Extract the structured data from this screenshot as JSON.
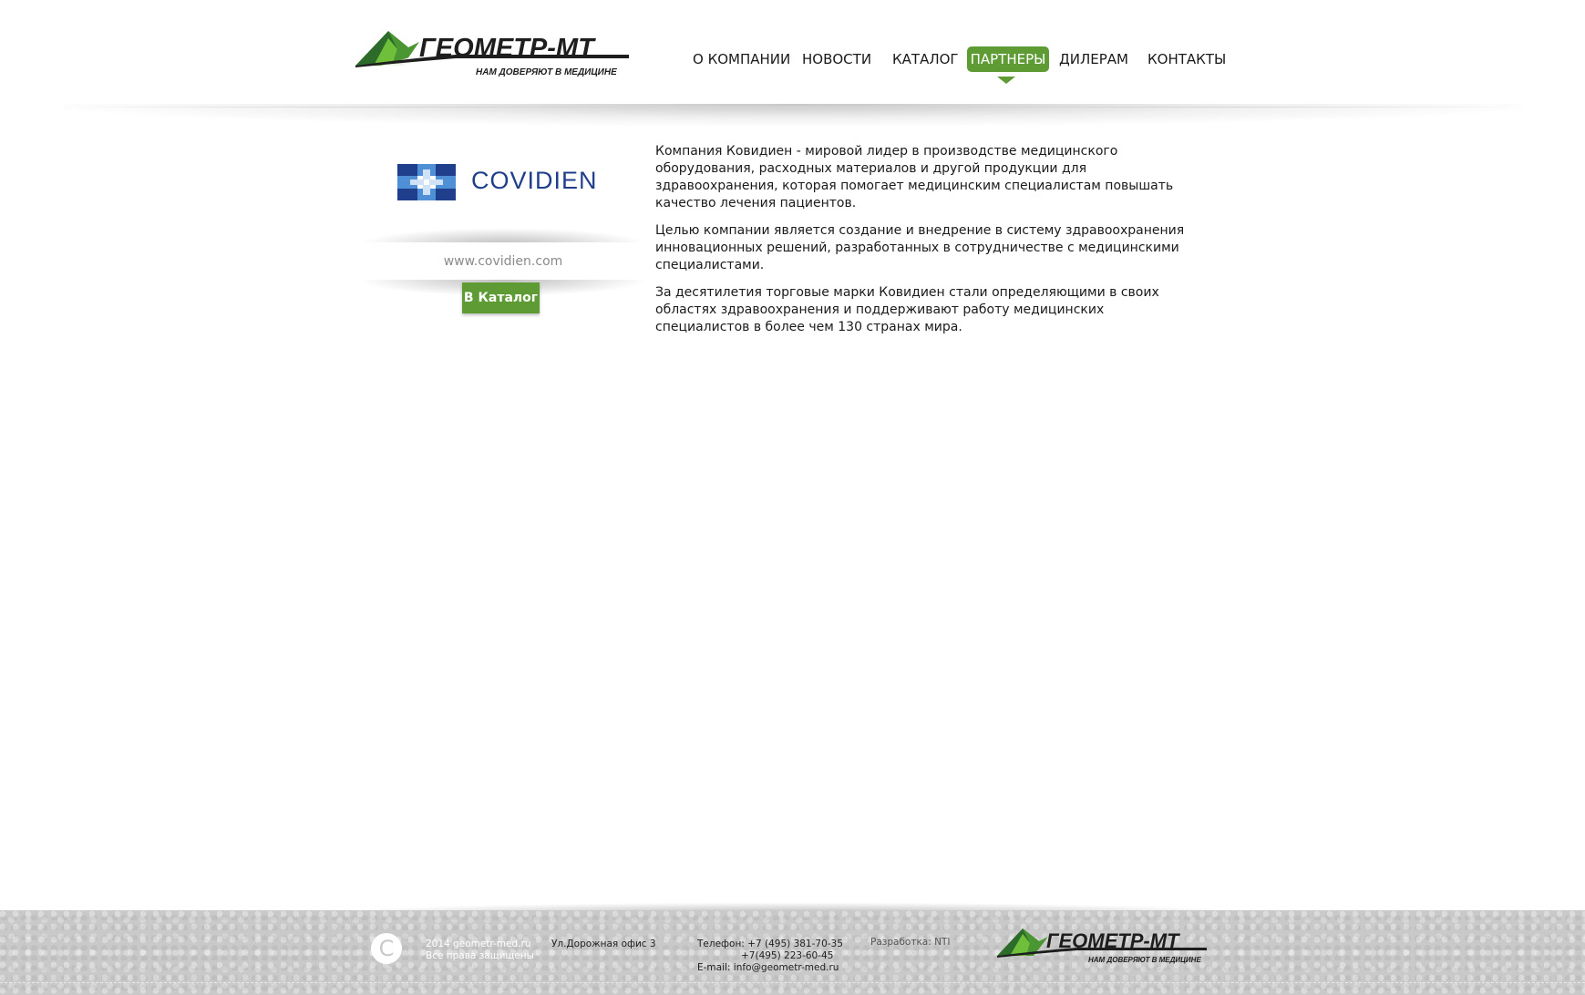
{
  "header": {
    "logo": {
      "name": "ГЕОМЕТР-МТ",
      "tagline": "НАМ ДОВЕРЯЮТ В МЕДИЦИНЕ"
    },
    "nav": [
      {
        "label": "О КОМПАНИИ",
        "active": false
      },
      {
        "label": "НОВОСТИ",
        "active": false
      },
      {
        "label": "КАТАЛОГ",
        "active": false
      },
      {
        "label": "ПАРТНЕРЫ",
        "active": true
      },
      {
        "label": "ДИЛЕРАМ",
        "active": false
      },
      {
        "label": "КОНТАКТЫ",
        "active": false
      }
    ]
  },
  "partner": {
    "logo_text": "COVIDIEN",
    "website": "www.covidien.com",
    "catalog_button": "В Каталог",
    "description": [
      "Компания Ковидиен - мировой лидер в производстве медицинского оборудования, расходных материалов и другой продукции для здравоохранения, которая помогает медицинским специалистам повышать качество лечения пациентов.",
      "Целью компании является создание и внедрение в систему здравоохранения инновационных решений, разработанных в сотрудничестве с медицинскими специалистами.",
      "За десятилетия торговые марки Ковидиен стали определяющими в своих областях здравоохранения и поддерживают работу медицинских специалистов в более чем 130 странах мира."
    ]
  },
  "footer": {
    "copyright_symbol": "C",
    "copyright_line1": "2014 geometr-med.ru",
    "copyright_line2": "Все права защищены",
    "address": "Ул.Дорожная  офис 3",
    "phone_line1": "Телефон: +7 (495) 381-70-35",
    "phone_line2": "+7(495) 223-60-45",
    "email": "E-mail: info@geometr-med.ru",
    "developer": "Разработка: NTI"
  },
  "colors": {
    "accent_green": "#5e9b34",
    "covidien_blue": "#1f3f8d",
    "footer_gray": "#c9c9c9"
  }
}
